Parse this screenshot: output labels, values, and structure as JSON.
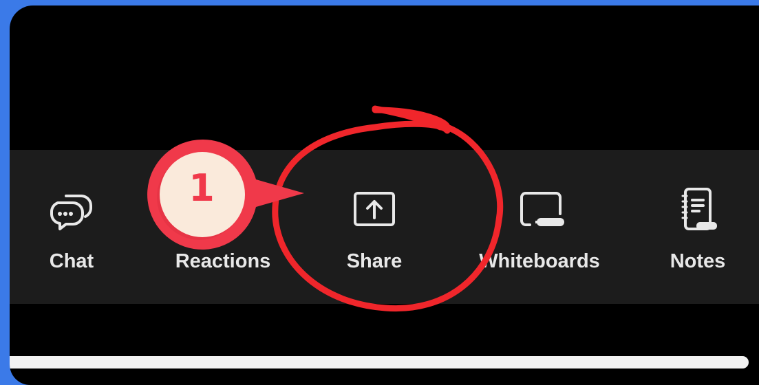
{
  "toolbar": {
    "items": [
      {
        "label": "Chat",
        "icon": "chat-bubbles-icon"
      },
      {
        "label": "Reactions",
        "icon": "reactions-icon"
      },
      {
        "label": "Share",
        "icon": "share-screen-icon"
      },
      {
        "label": "Whiteboards",
        "icon": "whiteboard-icon"
      },
      {
        "label": "Notes",
        "icon": "notes-icon"
      }
    ]
  },
  "annotation": {
    "step_number": "1",
    "badge_color": "#f0394a",
    "badge_inner_color": "#faeadb",
    "highlight_color": "#f0262b",
    "highlighted_item": "Share"
  },
  "colors": {
    "frame": "#3b7ae8",
    "screen": "#000000",
    "toolbar": "#1c1c1c",
    "text": "#e8e8e8"
  }
}
